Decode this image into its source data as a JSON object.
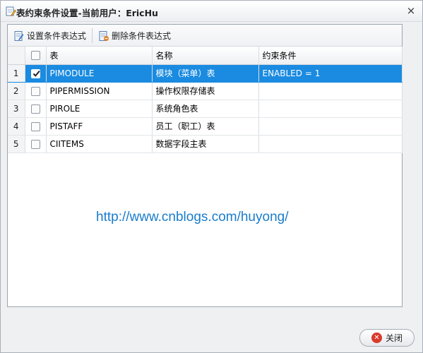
{
  "window": {
    "title": "表约束条件设置-当前用户：EricHu",
    "close_glyph": "×"
  },
  "toolbar": {
    "set_label": "设置条件表达式",
    "delete_label": "删除条件表达式"
  },
  "grid": {
    "columns": [
      "表",
      "名称",
      "约束条件"
    ],
    "rows": [
      {
        "num": "1",
        "checked": true,
        "table": "PIMODULE",
        "name": "模块（菜单）表",
        "constraint": "ENABLED = 1"
      },
      {
        "num": "2",
        "checked": false,
        "table": "PIPERMISSION",
        "name": "操作权限存储表",
        "constraint": ""
      },
      {
        "num": "3",
        "checked": false,
        "table": "PIROLE",
        "name": "系统角色表",
        "constraint": ""
      },
      {
        "num": "4",
        "checked": false,
        "table": "PISTAFF",
        "name": "员工（职工）表",
        "constraint": ""
      },
      {
        "num": "5",
        "checked": false,
        "table": "CIITEMS",
        "name": "数据字段主表",
        "constraint": ""
      }
    ]
  },
  "watermark": "http://www.cnblogs.com/huyong/",
  "footer": {
    "close_label": "关闭",
    "close_icon_glyph": "✕"
  },
  "colors": {
    "selection": "#1a8be0",
    "watermark": "#1a7ccc"
  }
}
